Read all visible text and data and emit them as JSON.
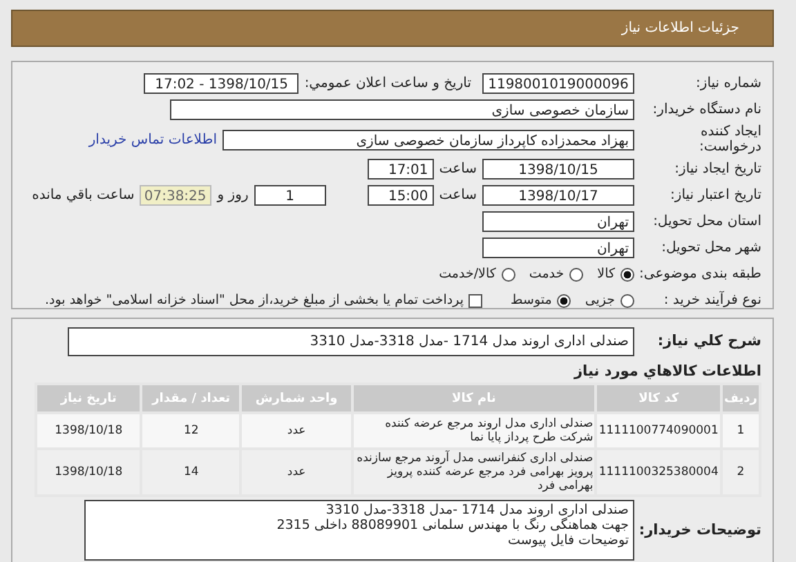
{
  "header": {
    "title": "جزئیات اطلاعات نیاز"
  },
  "details": {
    "need_number": {
      "label": "شماره نیاز:",
      "value": "1198001019000096"
    },
    "announce": {
      "label": "تاريخ و ساعت اعلان عمومي:",
      "value": "1398/10/15 - 17:02"
    },
    "buyer_org": {
      "label": "نام دستگاه خريدار:",
      "value": "سازمان خصوصی سازی"
    },
    "requester": {
      "label": "ايجاد کننده درخواست:",
      "value": "بهزاد محمدزاده کاپرداز سازمان خصوصی سازی",
      "link": "اطلاعات تماس خریدار"
    },
    "created": {
      "label": "تاريخ ايجاد نياز:",
      "date": "1398/10/15",
      "time_label": "ساعت",
      "time": "17:01"
    },
    "valid": {
      "label": "تاريخ اعتبار نياز:",
      "date": "1398/10/17",
      "time_label": "ساعت",
      "time": "15:00",
      "days": "1",
      "days_label": "روز و",
      "remaining": "07:38:25",
      "remaining_label": "ساعت باقي مانده"
    },
    "province": {
      "label": "استان محل تحويل:",
      "value": "تهران"
    },
    "city": {
      "label": "شهر محل تحويل:",
      "value": "تهران"
    },
    "category": {
      "label": "طبقه بندی موضوعی:",
      "options": [
        {
          "label": "کالا",
          "selected": true
        },
        {
          "label": "خدمت",
          "selected": false
        },
        {
          "label": "کالا/خدمت",
          "selected": false
        }
      ]
    },
    "process": {
      "label": "نوع فرآیند خرید :",
      "options": [
        {
          "label": "جزیی",
          "selected": false
        },
        {
          "label": "متوسط",
          "selected": true
        }
      ],
      "treasury": {
        "checked": false,
        "label": "پرداخت تمام يا بخشی از مبلغ خرید،از محل \"اسناد خزانه اسلامی\" خواهد بود."
      }
    }
  },
  "summary": {
    "label": "شرح کلي نياز:",
    "value": "صندلی اداری اروند مدل 1714 -مدل 3318-مدل 3310"
  },
  "goods": {
    "title": "اطلاعات کالاهاي مورد نياز",
    "columns": [
      "رديف",
      "کد کالا",
      "نام کالا",
      "واحد شمارش",
      "تعداد / مقدار",
      "تاريخ نياز"
    ],
    "rows": [
      [
        "1",
        "1111100774090001",
        "صندلی اداری مدل اروند مرجع عرضه کننده شرکت طرح پرداز پایا نما",
        "عدد",
        "12",
        "1398/10/18"
      ],
      [
        "2",
        "1111100325380004",
        "صندلی اداری کنفرانسی مدل آروند مرجع سازنده پرویز بهرامی فرد مرجع عرضه کننده پرویز بهرامی فرد",
        "عدد",
        "14",
        "1398/10/18"
      ]
    ]
  },
  "buyer_notes": {
    "label": "توضيحات خريدار:",
    "lines": [
      "صندلی اداری اروند مدل 1714 -مدل 3318-مدل 3310",
      "جهت هماهنگی رنگ با مهندس سلمانی 88089901 داخلی 2315",
      "توضیحات فایل پیوست"
    ]
  }
}
